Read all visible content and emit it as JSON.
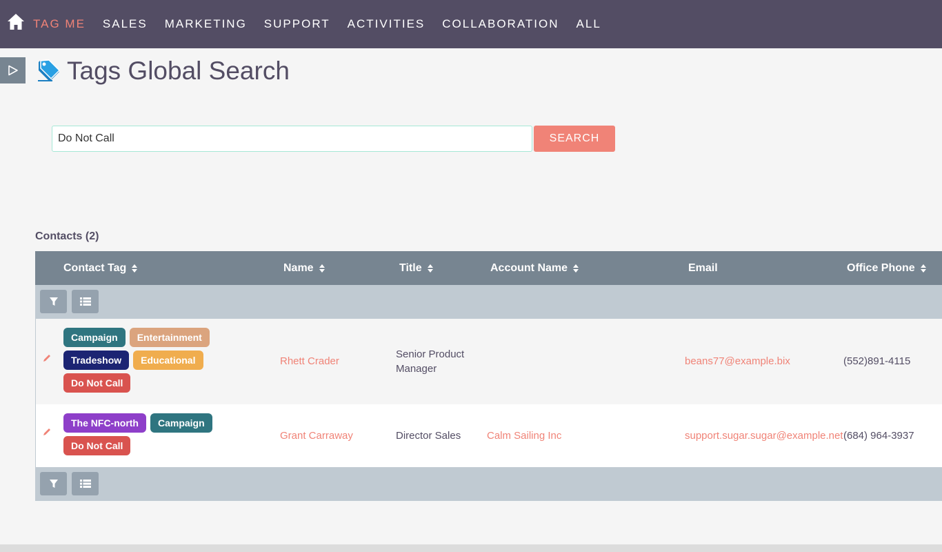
{
  "nav": {
    "items": [
      "TAG ME",
      "SALES",
      "MARKETING",
      "SUPPORT",
      "ACTIVITIES",
      "COLLABORATION",
      "ALL"
    ],
    "active_index": 0
  },
  "page": {
    "title": "Tags Global Search"
  },
  "search": {
    "value": "Do Not Call",
    "button_label": "SEARCH"
  },
  "contacts": {
    "header": "Contacts (2)",
    "columns": [
      "Contact Tag",
      "Name",
      "Title",
      "Account Name",
      "Email",
      "Office Phone"
    ],
    "rows": [
      {
        "tags": [
          [
            {
              "label": "Campaign",
              "color": "#2f7580"
            },
            {
              "label": "Entertainment",
              "color": "#dba47e"
            }
          ],
          [
            {
              "label": "Tradeshow",
              "color": "#1c2473"
            },
            {
              "label": "Educational",
              "color": "#f0ad4e"
            }
          ],
          [
            {
              "label": "Do Not Call",
              "color": "#d9534f"
            }
          ]
        ],
        "name": "Rhett Crader",
        "title_line1": "Senior Product",
        "title_line2": "Manager",
        "account": "",
        "email": "beans77@example.bix",
        "phone": "(552)891-4115"
      },
      {
        "tags": [
          [
            {
              "label": "The NFC-north",
              "color": "#8e3fc9"
            },
            {
              "label": "Campaign",
              "color": "#2f7580"
            }
          ],
          [
            {
              "label": "Do Not Call",
              "color": "#d9534f"
            }
          ]
        ],
        "name": "Grant Carraway",
        "title_line1": "Director Sales",
        "title_line2": "",
        "account": "Calm Sailing Inc",
        "email": "support.sugar.sugar@example.net",
        "phone": "(684) 964-3937"
      }
    ]
  },
  "colors": {
    "nav_bg": "#534d64",
    "accent": "#f08377",
    "table_header_bg": "#778591",
    "toolbar_bg": "#c0cad2"
  },
  "icons": {
    "home": "home-icon",
    "sidebar_toggle": "play-triangle-icon",
    "title": "tag-icon",
    "filter": "filter-icon",
    "column_chooser": "list-icon",
    "edit": "pencil-icon"
  }
}
